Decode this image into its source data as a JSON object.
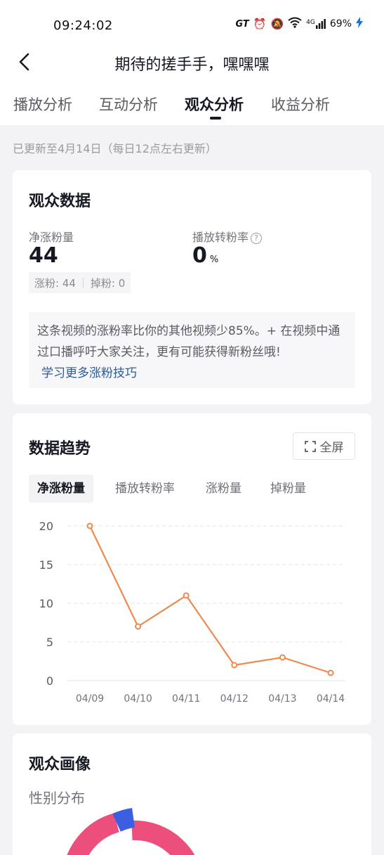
{
  "status": {
    "time": "09:24:02",
    "gt": "GT",
    "network": "4G",
    "battery": "69%"
  },
  "nav": {
    "title": "期待的搓手手，嘿嘿嘿"
  },
  "tabs": [
    {
      "label": "播放分析"
    },
    {
      "label": "互动分析"
    },
    {
      "label": "观众分析"
    },
    {
      "label": "收益分析"
    }
  ],
  "update_note": "已更新至4月14日（每日12点左右更新）",
  "audience_data": {
    "title": "观众数据",
    "net_gain_label": "净涨粉量",
    "net_gain_value": "44",
    "conversion_label": "播放转粉率",
    "conversion_value": "0",
    "conversion_unit": "%",
    "gain_text": "涨粉: 44",
    "loss_text": "掉粉: 0",
    "tip_text": "这条视频的涨粉率比你的其他视频少85%。+ 在视频中通过口播呼吁大家关注，更有可能获得新粉丝哦!",
    "tip_link": "学习更多涨粉技巧"
  },
  "trend": {
    "title": "数据趋势",
    "fullscreen_label": "全屏",
    "chart_tabs": [
      {
        "label": "净涨粉量"
      },
      {
        "label": "播放转粉率"
      },
      {
        "label": "涨粉量"
      },
      {
        "label": "掉粉量"
      }
    ]
  },
  "chart_data": {
    "type": "line",
    "categories": [
      "04/09",
      "04/10",
      "04/11",
      "04/12",
      "04/13",
      "04/14"
    ],
    "values": [
      20,
      7,
      11,
      2,
      3,
      1
    ],
    "ylim": [
      0,
      20
    ],
    "yticks": [
      "0",
      "5",
      "10",
      "15",
      "20"
    ],
    "grid": true,
    "line_color": "#ee8a4f"
  },
  "portrait": {
    "title": "观众画像",
    "gender_label": "性别分布"
  },
  "colors": {
    "accent": "#ee8a4f",
    "pink": "#ec4f7c",
    "blue": "#3c5fe0",
    "link": "#2b5a9e"
  }
}
